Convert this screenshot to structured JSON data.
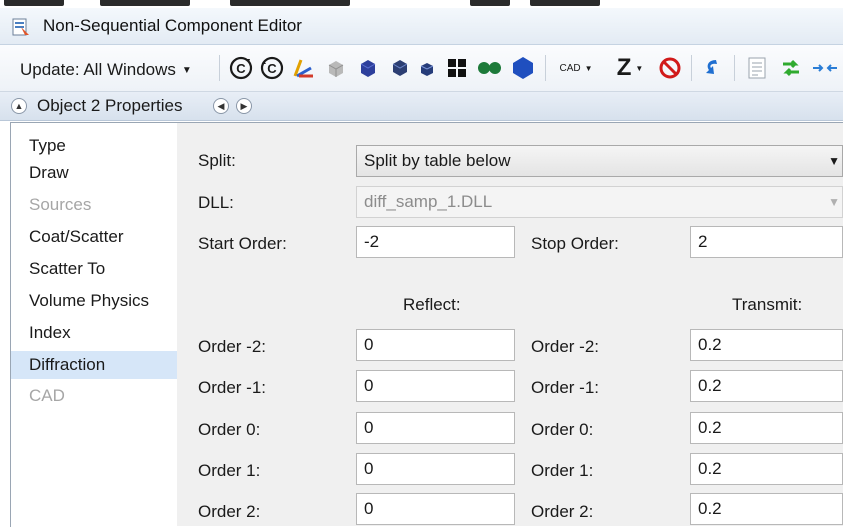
{
  "window": {
    "title": "Non-Sequential Component Editor"
  },
  "toolbar": {
    "update_label": "Update: All Windows",
    "cad_label": "CAD",
    "z_label": "Z",
    "icons": [
      "rotate-c-icon",
      "rotate-c-arrow-icon",
      "ray-trace-icon",
      "solid-box-gray-icon",
      "solid-box-blue-icon",
      "solid-box-dark-icon",
      "grid-squares-icon",
      "dots-icon",
      "hexagon-icon",
      "cad-dropdown",
      "z-dropdown",
      "no-entry-icon",
      "undo-arrow-icon",
      "document-icon",
      "swap-arrows-icon",
      "arrow-in-icon"
    ]
  },
  "properties_header": {
    "title": "Object 2 Properties"
  },
  "nav": {
    "items": [
      {
        "label": "Type",
        "state": "normal"
      },
      {
        "label": "Draw",
        "state": "normal"
      },
      {
        "label": "Sources",
        "state": "disabled"
      },
      {
        "label": "Coat/Scatter",
        "state": "normal"
      },
      {
        "label": "Scatter To",
        "state": "normal"
      },
      {
        "label": "Volume Physics",
        "state": "normal"
      },
      {
        "label": "Index",
        "state": "normal"
      },
      {
        "label": "Diffraction",
        "state": "selected"
      },
      {
        "label": "CAD",
        "state": "disabled"
      }
    ]
  },
  "form": {
    "split_label": "Split:",
    "split_value": "Split by table below",
    "dll_label": "DLL:",
    "dll_value": "diff_samp_1.DLL",
    "start_order_label": "Start Order:",
    "start_order_value": "-2",
    "stop_order_label": "Stop Order:",
    "stop_order_value": "2",
    "reflect_header": "Reflect:",
    "transmit_header": "Transmit:",
    "rows": [
      {
        "label": "Order -2:",
        "reflect": "0",
        "transmit": "0.2"
      },
      {
        "label": "Order -1:",
        "reflect": "0",
        "transmit": "0.2"
      },
      {
        "label": "Order 0:",
        "reflect": "0",
        "transmit": "0.2"
      },
      {
        "label": "Order 1:",
        "reflect": "0",
        "transmit": "0.2"
      },
      {
        "label": "Order 2:",
        "reflect": "0",
        "transmit": "0.2"
      }
    ]
  },
  "colors": {
    "selection": "#d6e6f8",
    "form_bg": "#f0f0f0",
    "disabled_text": "#a6a6a6"
  }
}
